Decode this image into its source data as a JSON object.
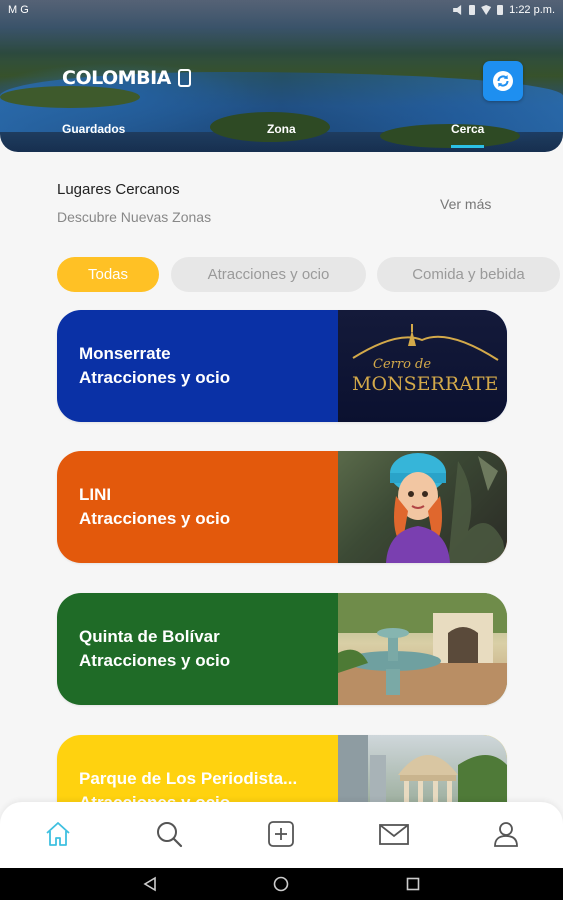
{
  "status_bar": {
    "left": "M G",
    "time": "1:22 p.m."
  },
  "header": {
    "logo_text": "COLOMBIA",
    "tabs": [
      {
        "label": "Guardados"
      },
      {
        "label": "Zona"
      },
      {
        "label": "Cerca",
        "active": true
      }
    ],
    "icons": {
      "sync": "sync-icon"
    },
    "colors": {
      "sync_button": "#1e8ff0",
      "active_tab_indicator": "#2cc0e6"
    }
  },
  "section": {
    "title": "Lugares Cercanos",
    "subtitle": "Descubre Nuevas Zonas",
    "see_more": "Ver más"
  },
  "filters": [
    {
      "label": "Todas",
      "active": true
    },
    {
      "label": "Atracciones y ocio",
      "active": false
    },
    {
      "label": "Comida y bebida",
      "active": false
    }
  ],
  "places": [
    {
      "name": "Monserrate",
      "category": "Atracciones y ocio",
      "color": "#0a31a6",
      "image_text": [
        "Cerro de",
        "MONSERRATE"
      ]
    },
    {
      "name": "LINI",
      "category": "Atracciones y ocio",
      "color": "#e3590c"
    },
    {
      "name": "Quinta de Bolívar",
      "category": "Atracciones y ocio",
      "color": "#1f6b27"
    },
    {
      "name": "Parque de Los Periodista...",
      "category": "Atracciones y ocio",
      "color": "#ffd20f"
    }
  ],
  "bottom_nav": [
    {
      "icon": "home-icon",
      "active": true
    },
    {
      "icon": "search-icon"
    },
    {
      "icon": "add-icon"
    },
    {
      "icon": "mail-icon"
    },
    {
      "icon": "profile-icon"
    }
  ],
  "colors": {
    "filter_active": "#ffc125",
    "home_active": "#3fc0e0"
  }
}
